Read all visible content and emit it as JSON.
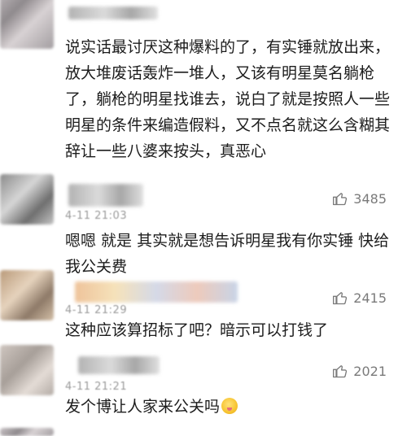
{
  "comments": [
    {
      "time": "",
      "text": "说实话最讨厌这种爆料的了，有实锤就放出来，放大堆废话轰炸一堆人，又该有明星莫名躺枪了，躺枪的明星找谁去，说白了就是按照人一些明星的条件来编造假料，又不点名就这么含糊其辞让一些八婆来按头，真恶心",
      "likes": ""
    },
    {
      "time": "4-11 21:03",
      "text": "嗯嗯 就是 其实就是想告诉明星我有你实锤 快给我公关费",
      "likes": "3485"
    },
    {
      "time": "4-11 21:29",
      "text": "这种应该算招标了吧？暗示可以打钱了",
      "likes": "2415"
    },
    {
      "time": "4-11 21:21",
      "text": "发个博让人家来公关吗",
      "likes": "2021"
    }
  ],
  "icons": {
    "like": "thumbs-up-icon",
    "emoji": "drooling-face-emoji"
  }
}
